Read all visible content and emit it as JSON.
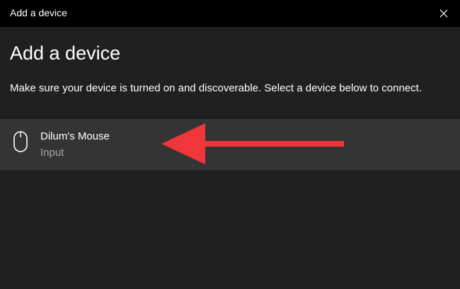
{
  "window": {
    "title": "Add a device"
  },
  "main": {
    "heading": "Add a device",
    "description": "Make sure your device is turned on and discoverable. Select a device below to connect."
  },
  "devices": [
    {
      "name": "Dilum's Mouse",
      "type": "Input",
      "icon": "mouse-icon"
    }
  ],
  "annotation": {
    "arrow_color": "#f0353b",
    "icon": "red-arrow-pointing-left"
  },
  "colors": {
    "titlebar_bg": "#000000",
    "window_bg": "#202020",
    "selected_item_bg": "#343434",
    "secondary_text": "#a6a6a6"
  }
}
